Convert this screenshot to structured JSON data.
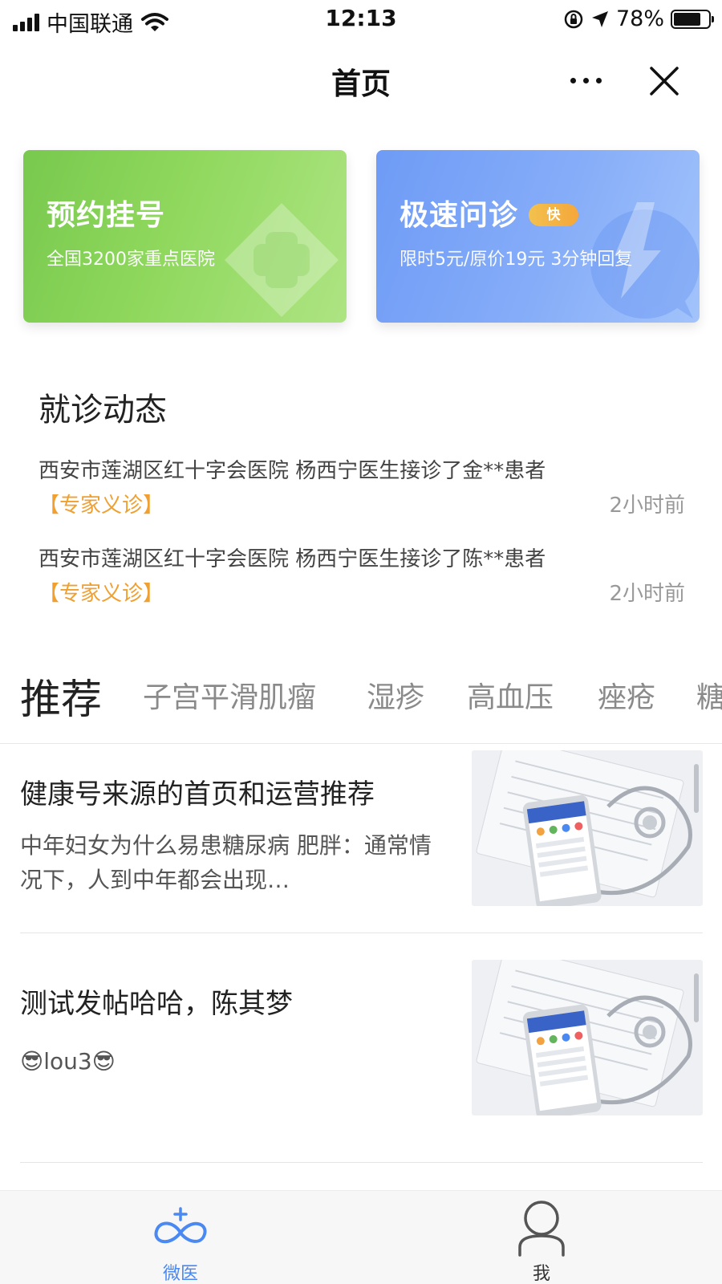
{
  "status_bar": {
    "carrier": "中国联通",
    "time": "12:13",
    "battery": "78%",
    "battery_level": 0.78
  },
  "nav": {
    "title": "首页"
  },
  "cards": {
    "appointment": {
      "title": "预约挂号",
      "subtitle": "全国3200家重点医院"
    },
    "consult": {
      "title": "极速问诊",
      "badge": "快",
      "subtitle": "限时5元/原价19元 3分钟回复"
    }
  },
  "visit_section": {
    "title": "就诊动态",
    "items": [
      {
        "text": "西安市莲湖区红十字会医院 杨西宁医生接诊了金**患者",
        "tag": "【专家义诊】",
        "time": "2小时前"
      },
      {
        "text": "西安市莲湖区红十字会医院 杨西宁医生接诊了陈**患者",
        "tag": "【专家义诊】",
        "time": "2小时前"
      }
    ]
  },
  "tabs": [
    "推荐",
    "子宫平滑肌瘤",
    "湿疹",
    "高血压",
    "痤疮",
    "糖"
  ],
  "articles": [
    {
      "title": "健康号来源的首页和运营推荐",
      "body": "中年妇女为什么易患糖尿病 肥胖：通常情况下，人到中年都会出现…"
    },
    {
      "title": "测试发帖哈哈，陈其梦",
      "body": "😎lou3😎"
    }
  ],
  "tab_bar": {
    "home_label": "微医",
    "me_label": "我"
  },
  "colors": {
    "green_card": "#7ccb52",
    "blue_card": "#7ba5f7",
    "tag_orange": "#f0a030",
    "tab_active_blue": "#4a88f2"
  }
}
